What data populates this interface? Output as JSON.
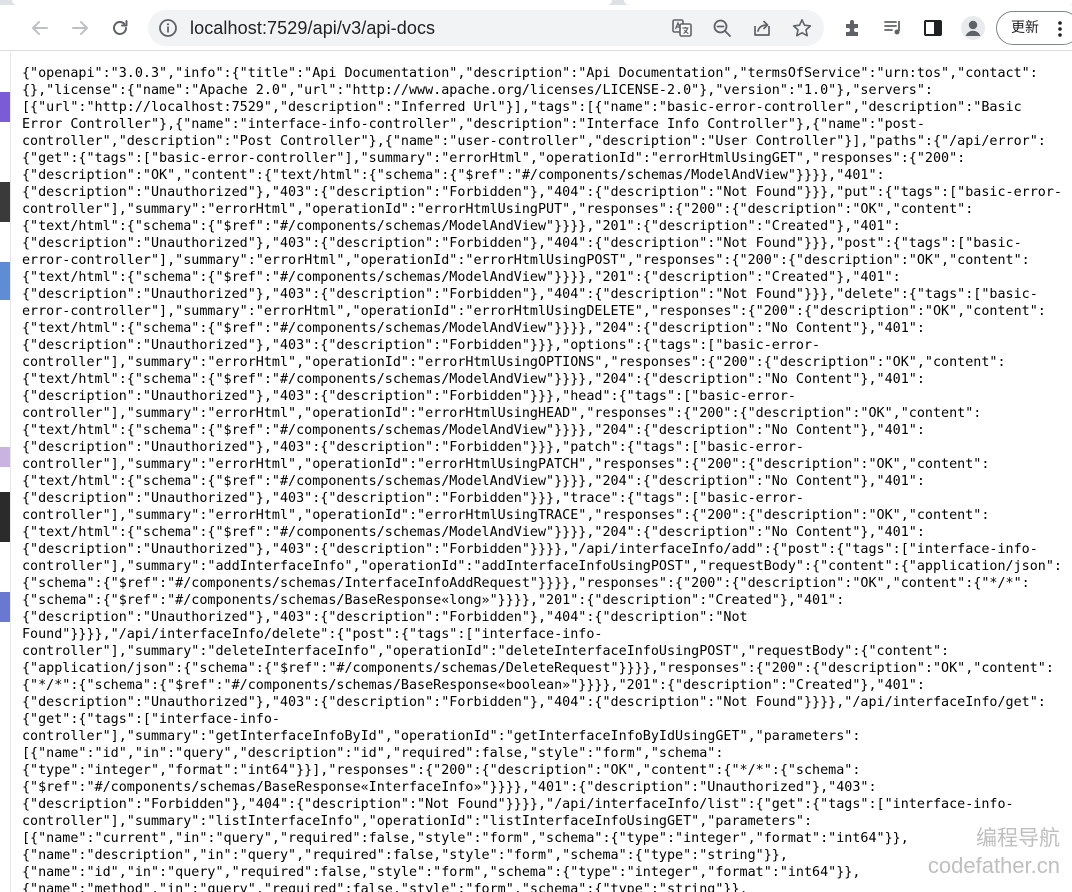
{
  "browser": {
    "url": "localhost:7529/api/v3/api-docs",
    "update_label": "更新"
  },
  "json_lines": [
    "{\"openapi\":\"3.0.3\",\"info\":{\"title\":\"Api Documentation\",\"description\":\"Api Documentation\",\"termsOfService\":\"urn:tos\",\"contact\":",
    "{},\"license\":{\"name\":\"Apache 2.0\",\"url\":\"http://www.apache.org/licenses/LICENSE-2.0\"},\"version\":\"1.0\"},\"servers\":",
    "[{\"url\":\"http://localhost:7529\",\"description\":\"Inferred Url\"}],\"tags\":[{\"name\":\"basic-error-controller\",\"description\":\"Basic",
    "Error Controller\"},{\"name\":\"interface-info-controller\",\"description\":\"Interface Info Controller\"},{\"name\":\"post-",
    "controller\",\"description\":\"Post Controller\"},{\"name\":\"user-controller\",\"description\":\"User Controller\"}],\"paths\":{\"/api/error\":",
    "{\"get\":{\"tags\":[\"basic-error-controller\"],\"summary\":\"errorHtml\",\"operationId\":\"errorHtmlUsingGET\",\"responses\":{\"200\":",
    "{\"description\":\"OK\",\"content\":{\"text/html\":{\"schema\":{\"$ref\":\"#/components/schemas/ModelAndView\"}}}},\"401\":",
    "{\"description\":\"Unauthorized\"},\"403\":{\"description\":\"Forbidden\"},\"404\":{\"description\":\"Not Found\"}}},\"put\":{\"tags\":[\"basic-error-",
    "controller\"],\"summary\":\"errorHtml\",\"operationId\":\"errorHtmlUsingPUT\",\"responses\":{\"200\":{\"description\":\"OK\",\"content\":",
    "{\"text/html\":{\"schema\":{\"$ref\":\"#/components/schemas/ModelAndView\"}}}},\"201\":{\"description\":\"Created\"},\"401\":",
    "{\"description\":\"Unauthorized\"},\"403\":{\"description\":\"Forbidden\"},\"404\":{\"description\":\"Not Found\"}}},\"post\":{\"tags\":[\"basic-",
    "error-controller\"],\"summary\":\"errorHtml\",\"operationId\":\"errorHtmlUsingPOST\",\"responses\":{\"200\":{\"description\":\"OK\",\"content\":",
    "{\"text/html\":{\"schema\":{\"$ref\":\"#/components/schemas/ModelAndView\"}}}},\"201\":{\"description\":\"Created\"},\"401\":",
    "{\"description\":\"Unauthorized\"},\"403\":{\"description\":\"Forbidden\"},\"404\":{\"description\":\"Not Found\"}}},\"delete\":{\"tags\":[\"basic-",
    "error-controller\"],\"summary\":\"errorHtml\",\"operationId\":\"errorHtmlUsingDELETE\",\"responses\":{\"200\":{\"description\":\"OK\",\"content\":",
    "{\"text/html\":{\"schema\":{\"$ref\":\"#/components/schemas/ModelAndView\"}}}},\"204\":{\"description\":\"No Content\"},\"401\":",
    "{\"description\":\"Unauthorized\"},\"403\":{\"description\":\"Forbidden\"}}},\"options\":{\"tags\":[\"basic-error-",
    "controller\"],\"summary\":\"errorHtml\",\"operationId\":\"errorHtmlUsingOPTIONS\",\"responses\":{\"200\":{\"description\":\"OK\",\"content\":",
    "{\"text/html\":{\"schema\":{\"$ref\":\"#/components/schemas/ModelAndView\"}}}},\"204\":{\"description\":\"No Content\"},\"401\":",
    "{\"description\":\"Unauthorized\"},\"403\":{\"description\":\"Forbidden\"}}},\"head\":{\"tags\":[\"basic-error-",
    "controller\"],\"summary\":\"errorHtml\",\"operationId\":\"errorHtmlUsingHEAD\",\"responses\":{\"200\":{\"description\":\"OK\",\"content\":",
    "{\"text/html\":{\"schema\":{\"$ref\":\"#/components/schemas/ModelAndView\"}}}},\"204\":{\"description\":\"No Content\"},\"401\":",
    "{\"description\":\"Unauthorized\"},\"403\":{\"description\":\"Forbidden\"}}},\"patch\":{\"tags\":[\"basic-error-",
    "controller\"],\"summary\":\"errorHtml\",\"operationId\":\"errorHtmlUsingPATCH\",\"responses\":{\"200\":{\"description\":\"OK\",\"content\":",
    "{\"text/html\":{\"schema\":{\"$ref\":\"#/components/schemas/ModelAndView\"}}}},\"204\":{\"description\":\"No Content\"},\"401\":",
    "{\"description\":\"Unauthorized\"},\"403\":{\"description\":\"Forbidden\"}}},\"trace\":{\"tags\":[\"basic-error-",
    "controller\"],\"summary\":\"errorHtml\",\"operationId\":\"errorHtmlUsingTRACE\",\"responses\":{\"200\":{\"description\":\"OK\",\"content\":",
    "{\"text/html\":{\"schema\":{\"$ref\":\"#/components/schemas/ModelAndView\"}}}},\"204\":{\"description\":\"No Content\"},\"401\":",
    "{\"description\":\"Unauthorized\"},\"403\":{\"description\":\"Forbidden\"}}}},\"/api/interfaceInfo/add\":{\"post\":{\"tags\":[\"interface-info-",
    "controller\"],\"summary\":\"addInterfaceInfo\",\"operationId\":\"addInterfaceInfoUsingPOST\",\"requestBody\":{\"content\":{\"application/json\":",
    "{\"schema\":{\"$ref\":\"#/components/schemas/InterfaceInfoAddRequest\"}}}},\"responses\":{\"200\":{\"description\":\"OK\",\"content\":{\"*/*\":",
    "{\"schema\":{\"$ref\":\"#/components/schemas/BaseResponse«long»\"}}}},\"201\":{\"description\":\"Created\"},\"401\":",
    "{\"description\":\"Unauthorized\"},\"403\":{\"description\":\"Forbidden\"},\"404\":{\"description\":\"Not",
    "Found\"}}}},\"/api/interfaceInfo/delete\":{\"post\":{\"tags\":[\"interface-info-",
    "controller\"],\"summary\":\"deleteInterfaceInfo\",\"operationId\":\"deleteInterfaceInfoUsingPOST\",\"requestBody\":{\"content\":",
    "{\"application/json\":{\"schema\":{\"$ref\":\"#/components/schemas/DeleteRequest\"}}}},\"responses\":{\"200\":{\"description\":\"OK\",\"content\":",
    "{\"*/*\":{\"schema\":{\"$ref\":\"#/components/schemas/BaseResponse«boolean»\"}}}},\"201\":{\"description\":\"Created\"},\"401\":",
    "{\"description\":\"Unauthorized\"},\"403\":{\"description\":\"Forbidden\"},\"404\":{\"description\":\"Not Found\"}}}},\"/api/interfaceInfo/get\":",
    "{\"get\":{\"tags\":[\"interface-info-",
    "controller\"],\"summary\":\"getInterfaceInfoById\",\"operationId\":\"getInterfaceInfoByIdUsingGET\",\"parameters\":",
    "[{\"name\":\"id\",\"in\":\"query\",\"description\":\"id\",\"required\":false,\"style\":\"form\",\"schema\":",
    "{\"type\":\"integer\",\"format\":\"int64\"}}],\"responses\":{\"200\":{\"description\":\"OK\",\"content\":{\"*/*\":{\"schema\":",
    "{\"$ref\":\"#/components/schemas/BaseResponse«InterfaceInfo»\"}}}},\"401\":{\"description\":\"Unauthorized\"},\"403\":",
    "{\"description\":\"Forbidden\"},\"404\":{\"description\":\"Not Found\"}}}},\"/api/interfaceInfo/list\":{\"get\":{\"tags\":[\"interface-info-",
    "controller\"],\"summary\":\"listInterfaceInfo\",\"operationId\":\"listInterfaceInfoUsingGET\",\"parameters\":",
    "[{\"name\":\"current\",\"in\":\"query\",\"required\":false,\"style\":\"form\",\"schema\":{\"type\":\"integer\",\"format\":\"int64\"}},",
    "{\"name\":\"description\",\"in\":\"query\",\"required\":false,\"style\":\"form\",\"schema\":{\"type\":\"string\"}},",
    "{\"name\":\"id\",\"in\":\"query\",\"required\":false,\"style\":\"form\",\"schema\":{\"type\":\"integer\",\"format\":\"int64\"}},",
    "{\"name\":\"method\",\"in\":\"query\",\"required\":false,\"style\":\"form\",\"schema\":{\"type\":\"string\"}},"
  ],
  "watermark": {
    "cn": "编程导航",
    "en": "codefather.cn"
  },
  "icons": {
    "back": "back-arrow-icon",
    "forward": "forward-arrow-icon",
    "reload": "reload-icon",
    "site_info": "site-info-icon",
    "translate": "translate-icon",
    "zoom": "zoom-icon",
    "share": "share-icon",
    "bookmark": "star-icon",
    "extensions": "puzzle-icon",
    "media": "media-control-icon",
    "side_panel": "side-panel-icon",
    "profile": "profile-icon",
    "menu": "kebab-menu-icon"
  },
  "colors": {
    "toolbar_icon": "#5f6368",
    "omnibox_bg": "#f1f3f4",
    "text": "#000000",
    "watermark": "#bfbfbf"
  }
}
